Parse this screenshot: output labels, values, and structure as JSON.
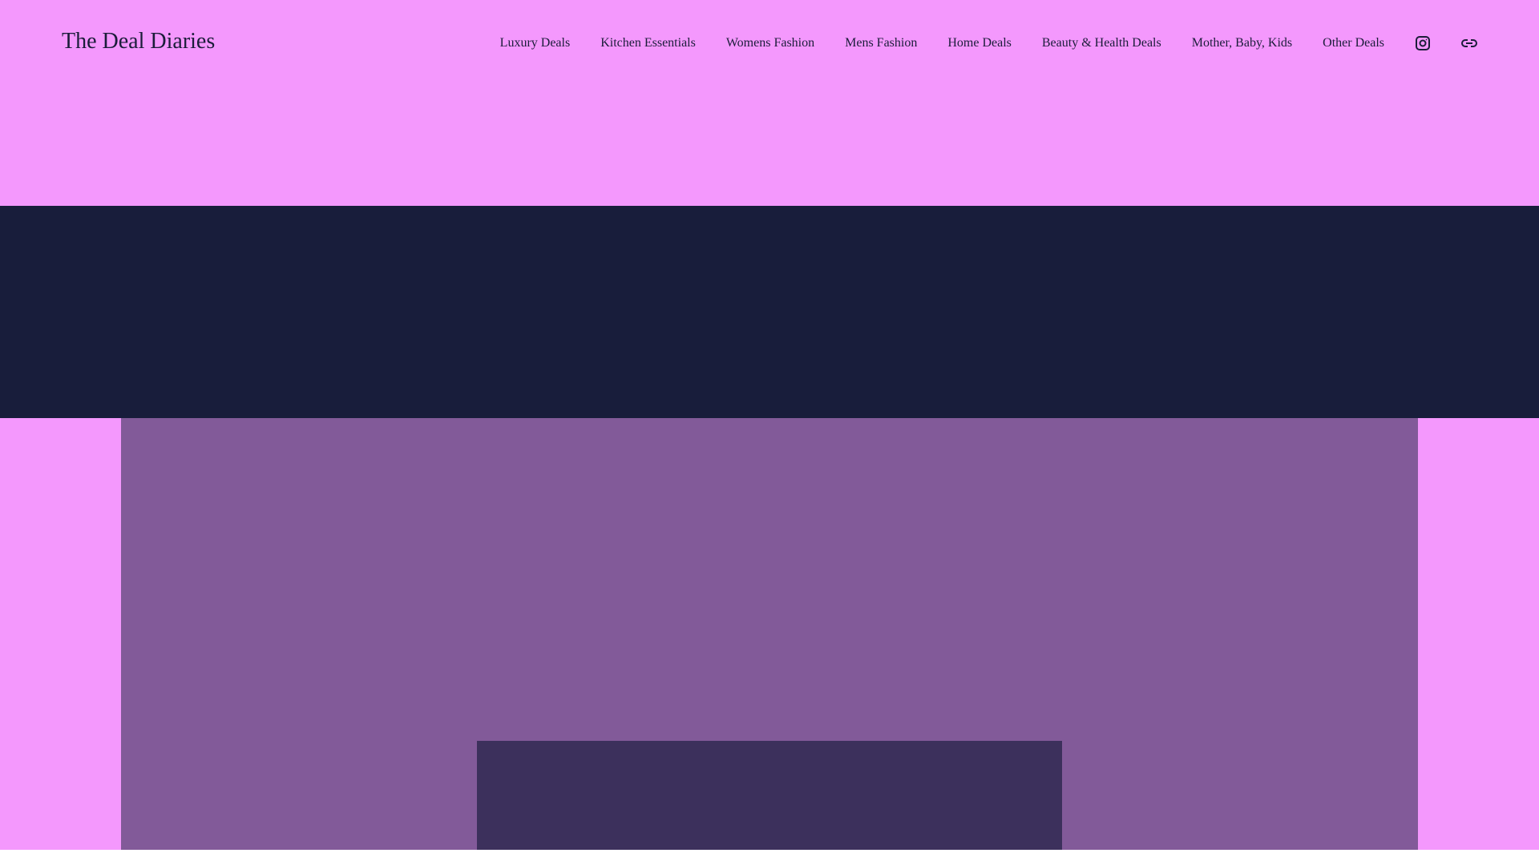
{
  "header": {
    "title": "The Deal Diaries",
    "nav": [
      "Luxury Deals",
      "Kitchen Essentials",
      "Womens Fashion",
      "Mens Fashion",
      "Home Deals",
      "Beauty & Health Deals",
      "Mother, Baby, Kids",
      "Other Deals"
    ],
    "icons": [
      "instagram-icon",
      "link-icon"
    ]
  },
  "colors": {
    "header_bg": "#f498fd",
    "band": "#181d3b",
    "panel": "#825a99",
    "inner": "#3c305c",
    "text": "#1b1d3a"
  }
}
